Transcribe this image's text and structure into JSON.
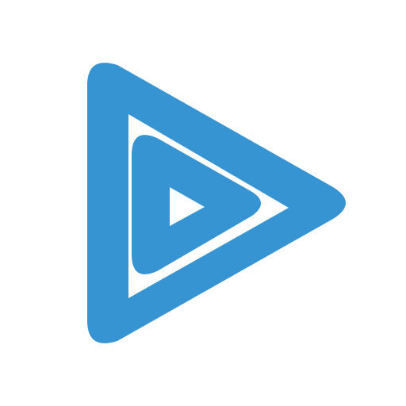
{
  "icon": {
    "name": "play-logo-icon",
    "primary_color": "#3594d1",
    "background_color": "#ffffff"
  }
}
